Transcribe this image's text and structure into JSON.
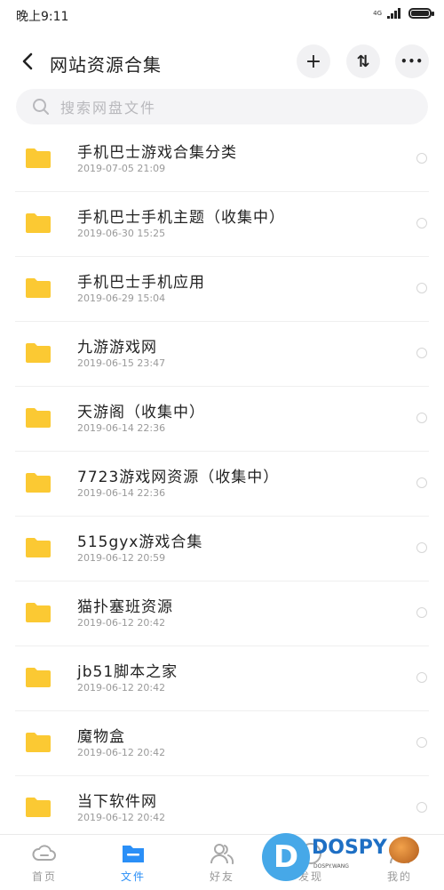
{
  "status_bar": {
    "time": "晚上9:11",
    "network": "4G"
  },
  "header": {
    "title": "网站资源合集",
    "add_symbol": "+",
    "sort_symbol": "⇅",
    "more_symbol": "•••"
  },
  "search": {
    "placeholder": "搜索网盘文件"
  },
  "files": [
    {
      "name": "手机巴士游戏合集分类",
      "date": "2019-07-05  21:09"
    },
    {
      "name": "手机巴士手机主题（收集中）",
      "date": "2019-06-30  15:25"
    },
    {
      "name": "手机巴士手机应用",
      "date": "2019-06-29  15:04"
    },
    {
      "name": "九游游戏网",
      "date": "2019-06-15  23:47"
    },
    {
      "name": "天游阁（收集中）",
      "date": "2019-06-14  22:36"
    },
    {
      "name": "7723游戏网资源（收集中）",
      "date": "2019-06-14  22:36"
    },
    {
      "name": "515gyx游戏合集",
      "date": "2019-06-12  20:59"
    },
    {
      "name": "猫扑塞班资源",
      "date": "2019-06-12  20:42"
    },
    {
      "name": "jb51脚本之家",
      "date": "2019-06-12  20:42"
    },
    {
      "name": "魔物盒",
      "date": "2019-06-12  20:42"
    },
    {
      "name": "当下软件网",
      "date": "2019-06-12  20:42"
    }
  ],
  "bottom_nav": {
    "home": "首页",
    "files": "文件",
    "friends": "好友",
    "discover": "发现",
    "mine": "我的"
  },
  "watermark": {
    "logo_letter": "D",
    "brand": "DOSPY",
    "sub": "DOSPY.WANG"
  },
  "colors": {
    "accent": "#2a8ff7",
    "folder": "#fbc933"
  }
}
